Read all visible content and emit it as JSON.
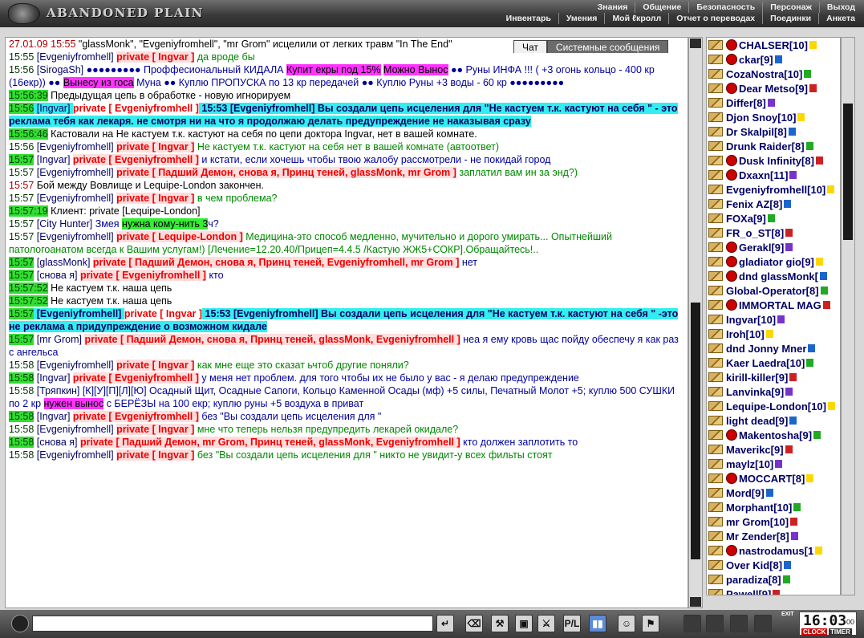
{
  "app": {
    "logo": "ABANDONED PLAIN"
  },
  "nav": {
    "top": [
      "Знания",
      "Общение",
      "Безопасность",
      "Персонаж",
      "Выход"
    ],
    "bottom": [
      "Инвентарь",
      "Умения",
      "Мой ℓкролл",
      "Отчет о переводах",
      "Поединки",
      "Анкета"
    ]
  },
  "tabs": [
    "Чат",
    "Системные сообщения"
  ],
  "chat": [
    {
      "t": "27.01.09 15:55",
      "tcls": "red",
      "segs": [
        [
          "msg-dark",
          " \"glassMonk\", \"Evgeniyfromhell\", \"mr Grom\" исцелили от легких травм \"In The End\""
        ]
      ]
    },
    {
      "t": "15:55",
      "segs": [
        [
          "nick",
          " [Evgeniyfromhell] "
        ],
        [
          "priv bg",
          "private [ Ingvar ]"
        ],
        [
          "msg-green",
          " да вроде бы"
        ]
      ]
    },
    {
      "t": "15:56",
      "segs": [
        [
          "nick",
          " [SirogaSh] "
        ],
        [
          "msg-blue",
          "●●●●●●●●● Проффесиональный КИДАЛА "
        ],
        [
          "hl-pink",
          "Купит екры под 15%"
        ],
        [
          "msg-blue",
          " "
        ],
        [
          "hl-pink",
          "Можно Вынос"
        ],
        [
          "msg-blue",
          " ●● Руны ИНФА !!! ( +3 огонь кольцо - 400 кр (16екр)) ●● "
        ],
        [
          "hl-pink",
          "Вынесу из госа"
        ],
        [
          "msg-blue",
          " Муна ●● Куплю ПРОПУСКА по 13 кр передачей ●● Куплю Руны +3 воды - 60 кр ●●●●●●●●●"
        ]
      ]
    },
    {
      "t": "15:56:39",
      "tcls": "hl",
      "segs": [
        [
          "msg-dark bold",
          " Предыдущая цепь в обработке - новую игнорируем"
        ]
      ]
    },
    {
      "t": "15:56",
      "tcls": "hl",
      "segs": [
        [
          "nick hl-cyan",
          " [Ingvar] "
        ],
        [
          "priv",
          "private [ Evgeniyfromhell ]"
        ],
        [
          "nick bold hl-cyan",
          " 15:53 [Evgeniyfromhell] Вы создали цепь исцеления для \"Не кастуем т.к. кастуют на себя \" - это реклама тебя как лекаря. не смотря ни на что я продолжаю делать предупреждение не наказывая сразу"
        ]
      ]
    },
    {
      "t": "15:56:46",
      "tcls": "hl",
      "segs": [
        [
          "msg-dark",
          " Кастовали на "
        ],
        [
          "msg-dark bold",
          "Не кастуем т.к. кастуют на себя"
        ],
        [
          "msg-dark",
          " по цепи доктора "
        ],
        [
          "msg-dark bold",
          "Ingvar"
        ],
        [
          "msg-dark",
          ", нет в вашей комнате."
        ]
      ]
    },
    {
      "t": "15:56",
      "segs": [
        [
          "nick",
          " [Evgeniyfromhell] "
        ],
        [
          "priv bg",
          "private [ Ingvar ]"
        ],
        [
          "msg-green",
          " Не кастуем т.к. кастуют на себя нет в вашей комнате (автоответ)"
        ]
      ]
    },
    {
      "t": "15:57",
      "tcls": "hl",
      "segs": [
        [
          "nick",
          " [Ingvar] "
        ],
        [
          "priv bg",
          "private [ Evgeniyfromhell ]"
        ],
        [
          "msg-blue",
          " и кстати, если хочешь чтобы твою жалобу рассмотрели - не покидай город"
        ]
      ]
    },
    {
      "t": "15:57",
      "segs": [
        [
          "nick",
          " [Evgeniyfromhell] "
        ],
        [
          "priv bg",
          "private [ Падший Демон, снова я, Принц теней, glassMonk, mr Grom ]"
        ],
        [
          "msg-green",
          " заплатил вам ин за энд?)"
        ]
      ]
    },
    {
      "t": "15:57",
      "tcls": "red",
      "segs": [
        [
          "msg-dark",
          " Бой между "
        ],
        [
          "msg-dark bold",
          "Вовлище"
        ],
        [
          "msg-dark",
          " и "
        ],
        [
          "msg-dark bold",
          "Lequipe-London"
        ],
        [
          "msg-dark",
          " закончен."
        ]
      ]
    },
    {
      "t": "15:57",
      "segs": [
        [
          "nick",
          " [Evgeniyfromhell] "
        ],
        [
          "priv bg",
          "private [ Ingvar ]"
        ],
        [
          "msg-green",
          " в чем проблема?"
        ]
      ]
    },
    {
      "t": "15:57:19",
      "tcls": "hl",
      "segs": [
        [
          "msg-dark",
          " Клиент: private [Lequipe-London]"
        ]
      ]
    },
    {
      "t": "15:57",
      "segs": [
        [
          "nick",
          " [City Hunter] "
        ],
        [
          "msg-blue",
          "Змея "
        ],
        [
          "hl-green",
          "нужна кому-нить 3"
        ],
        [
          "msg-blue",
          "ч?"
        ]
      ]
    },
    {
      "t": "15:57",
      "segs": [
        [
          "nick",
          " [Evgeniyfromhell] "
        ],
        [
          "priv bg",
          "private [ Lequipe-London ]"
        ],
        [
          "msg-green",
          " Медицина-это способ медленно, мучительно и дорого умирать... Опытнейший патологоанатом всегда к Вашим услугам!) [Лечение=12.20.40/Прицеп=4.4.5 /Кастую ЖЖ5+СОКР].Обращайтесь!.."
        ]
      ]
    },
    {
      "t": "15:57",
      "tcls": "hl",
      "segs": [
        [
          "nick",
          " [glassMonk] "
        ],
        [
          "priv bg",
          "private [ Падший Демон, снова я, Принц теней, Evgeniyfromhell, mr Grom ]"
        ],
        [
          "msg-blue",
          " нет"
        ]
      ]
    },
    {
      "t": "15:57",
      "tcls": "hl",
      "segs": [
        [
          "nick",
          " [снова я] "
        ],
        [
          "priv bg",
          "private [ Evgeniyfromhell ]"
        ],
        [
          "msg-blue",
          " кто"
        ]
      ]
    },
    {
      "t": "15:57:52",
      "tcls": "hl",
      "segs": [
        [
          "msg-dark",
          " Не кастуем т.к. наша цепь"
        ]
      ]
    },
    {
      "t": "15:57:52",
      "tcls": "hl",
      "segs": [
        [
          "msg-dark",
          " Не кастуем т.к. наша цепь"
        ]
      ]
    },
    {
      "t": "15:57",
      "tcls": "hl",
      "segs": [
        [
          "nick bold hl-cyan",
          " [Evgeniyfromhell] "
        ],
        [
          "priv",
          "private [ Ingvar ]"
        ],
        [
          "nick bold hl-cyan",
          " 15:53 [Evgeniyfromhell] Вы создали цепь исцеления для \"Не кастуем т.к. кастуют на себя \" -это не реклама а придупреждение о возможном кидале"
        ]
      ]
    },
    {
      "t": "15:57",
      "tcls": "hl",
      "segs": [
        [
          "nick",
          " [mr Grom] "
        ],
        [
          "priv bg",
          "private [ Падший Демон, снова я, Принц теней, glassMonk, Evgeniyfromhell ]"
        ],
        [
          "msg-blue",
          " неа я ему кровь щас пойду обеспечу я как раз с ангельса"
        ]
      ]
    },
    {
      "t": "15:58",
      "segs": [
        [
          "nick",
          " [Evgeniyfromhell] "
        ],
        [
          "priv bg",
          "private [ Ingvar ]"
        ],
        [
          "msg-green",
          " как мне еще это сказат ьчтоб другие поняли?"
        ]
      ]
    },
    {
      "t": "15:58",
      "tcls": "hl",
      "segs": [
        [
          "nick",
          " [Ingvar] "
        ],
        [
          "priv bg",
          "private [ Evgeniyfromhell ]"
        ],
        [
          "msg-blue",
          " у меня нет проблем. для того чтобы их не было у вас - я делаю предупреждение"
        ]
      ]
    },
    {
      "t": "15:58",
      "segs": [
        [
          "nick",
          " [Тряпкин] "
        ],
        [
          "msg-blue",
          "    [К][У][П][Л][Ю] Осадный Щит, Осадные Сапоги, Кольцо Каменной Осады (мф) +5 силы, Печатный Молот +5; куплю 500 СУШКИ по 2 кр "
        ],
        [
          "hl-pink",
          "нужен вынос"
        ],
        [
          "msg-blue",
          " с БЕРЁЗЫ на 100 екр; куплю руны +5 воздуха в приват"
        ]
      ]
    },
    {
      "t": "15:58",
      "tcls": "hl",
      "segs": [
        [
          "nick",
          " [Ingvar] "
        ],
        [
          "priv bg",
          "private [ Evgeniyfromhell ]"
        ],
        [
          "msg-blue",
          " без \"Вы создали цепь исцеления для \""
        ]
      ]
    },
    {
      "t": "15:58",
      "segs": [
        [
          "nick",
          " [Evgeniyfromhell] "
        ],
        [
          "priv bg",
          "private [ Ingvar ]"
        ],
        [
          "msg-green",
          " мне что теперь нельзя предупредить лекарей окидале?"
        ]
      ]
    },
    {
      "t": "15:58",
      "tcls": "hl",
      "segs": [
        [
          "nick",
          " [снова я] "
        ],
        [
          "priv bg",
          "private [ Падший Демон, mr Grom, Принц теней, glassMonk, Evgeniyfromhell ]"
        ],
        [
          "msg-blue",
          " кто должен заплотить то"
        ]
      ]
    },
    {
      "t": "15:58",
      "segs": [
        [
          "nick",
          " [Evgeniyfromhell] "
        ],
        [
          "priv bg",
          "private [ Ingvar ]"
        ],
        [
          "msg-green",
          " без \"Вы создали цепь исцеления для \" никто не увидит-у всех фильты стоят"
        ]
      ]
    }
  ],
  "users": [
    {
      "name": "CHALSER[10]",
      "clan": true
    },
    {
      "name": "ckar[9]",
      "clan": true
    },
    {
      "name": "CozaNostra[10]",
      "clan": false
    },
    {
      "name": "Dear Metso[9]",
      "clan": true
    },
    {
      "name": "Differ[8]",
      "clan": false
    },
    {
      "name": "Djon Snoy[10]",
      "clan": false
    },
    {
      "name": "Dr Skalpil[8]",
      "clan": false
    },
    {
      "name": "Drunk Raider[8]",
      "clan": false
    },
    {
      "name": "Dusk Infinity[8]",
      "clan": true
    },
    {
      "name": "Dxaxn[11]",
      "clan": true
    },
    {
      "name": "Evgeniyfromhell[10]",
      "clan": false
    },
    {
      "name": "Fenix AZ[8]",
      "clan": false
    },
    {
      "name": "FOXa[9]",
      "clan": false
    },
    {
      "name": "FR_o_ST[8]",
      "clan": false
    },
    {
      "name": "Gerakl[9]",
      "clan": true
    },
    {
      "name": "gladiator gio[9]",
      "clan": true
    },
    {
      "name": "dnd glassMonk[",
      "clan": true
    },
    {
      "name": "Global-Operator[8]",
      "clan": false
    },
    {
      "name": "IMMORTAL MAG",
      "clan": true
    },
    {
      "name": "Ingvar[10]",
      "clan": false
    },
    {
      "name": "Iroh[10]",
      "clan": false
    },
    {
      "name": "dnd Jonny Mner",
      "clan": false
    },
    {
      "name": "Kaer Laedra[10]",
      "clan": false
    },
    {
      "name": "kirill-killer[9]",
      "clan": false
    },
    {
      "name": "Lanvinka[9]",
      "clan": false
    },
    {
      "name": "Lequipe-London[10]",
      "clan": false
    },
    {
      "name": "light dead[9]",
      "clan": false
    },
    {
      "name": "Makentosha[9]",
      "clan": true
    },
    {
      "name": "Maverikc[9]",
      "clan": false
    },
    {
      "name": "maylz[10]",
      "clan": false
    },
    {
      "name": "MOCCART[8]",
      "clan": true
    },
    {
      "name": "Mord[9]",
      "clan": false
    },
    {
      "name": "Morphant[10]",
      "clan": false
    },
    {
      "name": "mr Grom[10]",
      "clan": false
    },
    {
      "name": "Mr Zender[8]",
      "clan": false
    },
    {
      "name": "nastrodamus[1",
      "clan": true
    },
    {
      "name": "Over Kid[8]",
      "clan": false
    },
    {
      "name": "paradiza[8]",
      "clan": false
    },
    {
      "name": "Pawell[9]",
      "clan": false
    }
  ],
  "toolbar": [
    "↵",
    "⌫",
    "⚒",
    "▣",
    "⚔",
    "P/L",
    "▮▮",
    "☺",
    "⚑"
  ],
  "clock": {
    "time": "16:03",
    "sec": "00",
    "label1": "CLOCK",
    "label2": "TIMER",
    "exit": "EXIT"
  },
  "colors": {
    "privateRed": "#ee0000",
    "nickBlue": "#000066",
    "cyanHighlight": "#33eeee",
    "magentaHighlight": "#ff33ff",
    "timeGreen": "#33dd33"
  }
}
